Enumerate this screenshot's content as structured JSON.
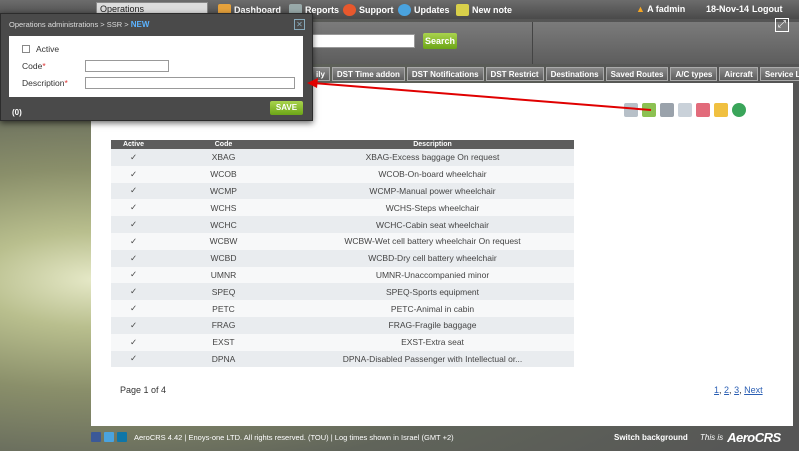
{
  "topbar": {
    "ops_select": "Operations administrations",
    "nav": [
      {
        "label": "Dashboard",
        "icon": "dashboard-icon"
      },
      {
        "label": "Reports",
        "icon": "reports-icon"
      },
      {
        "label": "Support",
        "icon": "support-icon"
      },
      {
        "label": "Updates",
        "icon": "twitter-icon"
      },
      {
        "label": "New note",
        "icon": "note-icon"
      }
    ],
    "user": "A fadmin",
    "date": "18-Nov-14",
    "logout": "Logout"
  },
  "search": {
    "button_label": "Search",
    "value": ""
  },
  "tabs": [
    "ily",
    "DST Time addon",
    "DST Notifications",
    "DST Restrict",
    "Destinations",
    "Saved Routes",
    "A/C types",
    "Aircraft",
    "Service Loads"
  ],
  "table": {
    "headers": [
      "Active",
      "Code",
      "Description"
    ],
    "rows": [
      {
        "active": "✓",
        "code": "XBAG",
        "description": "XBAG-Excess baggage On request"
      },
      {
        "active": "✓",
        "code": "WCOB",
        "description": "WCOB-On-board wheelchair"
      },
      {
        "active": "✓",
        "code": "WCMP",
        "description": "WCMP-Manual power wheelchair"
      },
      {
        "active": "✓",
        "code": "WCHS",
        "description": "WCHS-Steps wheelchair"
      },
      {
        "active": "✓",
        "code": "WCHC",
        "description": "WCHC-Cabin seat wheelchair"
      },
      {
        "active": "✓",
        "code": "WCBW",
        "description": "WCBW-Wet cell battery wheelchair On request"
      },
      {
        "active": "✓",
        "code": "WCBD",
        "description": "WCBD-Dry cell battery wheelchair"
      },
      {
        "active": "✓",
        "code": "UMNR",
        "description": "UMNR-Unaccompanied minor"
      },
      {
        "active": "✓",
        "code": "SPEQ",
        "description": "SPEQ-Sports equipment"
      },
      {
        "active": "✓",
        "code": "PETC",
        "description": "PETC-Animal in cabin"
      },
      {
        "active": "✓",
        "code": "FRAG",
        "description": "FRAG-Fragile baggage"
      },
      {
        "active": "✓",
        "code": "EXST",
        "description": "EXST-Extra seat"
      },
      {
        "active": "✓",
        "code": "DPNA",
        "description": "DPNA-Disabled Passenger with Intellectual or..."
      }
    ]
  },
  "pagination": {
    "info": "Page 1 of 4",
    "pages": [
      "1",
      "2",
      "3"
    ],
    "next": "Next"
  },
  "footer": {
    "text": "AeroCRS 4.42 | Enoys-one LTD. All rights reserved. (TOU) | Log times shown in Israel (GMT +2)",
    "switch_background": "Switch background",
    "this_is": "This is",
    "brand": "AeroCRS"
  },
  "modal": {
    "breadcrumb": "Operations administrations > SSR > ",
    "breadcrumb_new": "NEW",
    "active_label": "Active",
    "code_label": "Code",
    "description_label": "Description",
    "required_mark": "*",
    "code_value": "",
    "description_value": "",
    "save_label": "SAVE",
    "count": "(0)"
  },
  "colors": {
    "accent_green": "#6ca517",
    "arrow_red": "#e00000",
    "link_blue": "#2b5fb4"
  }
}
